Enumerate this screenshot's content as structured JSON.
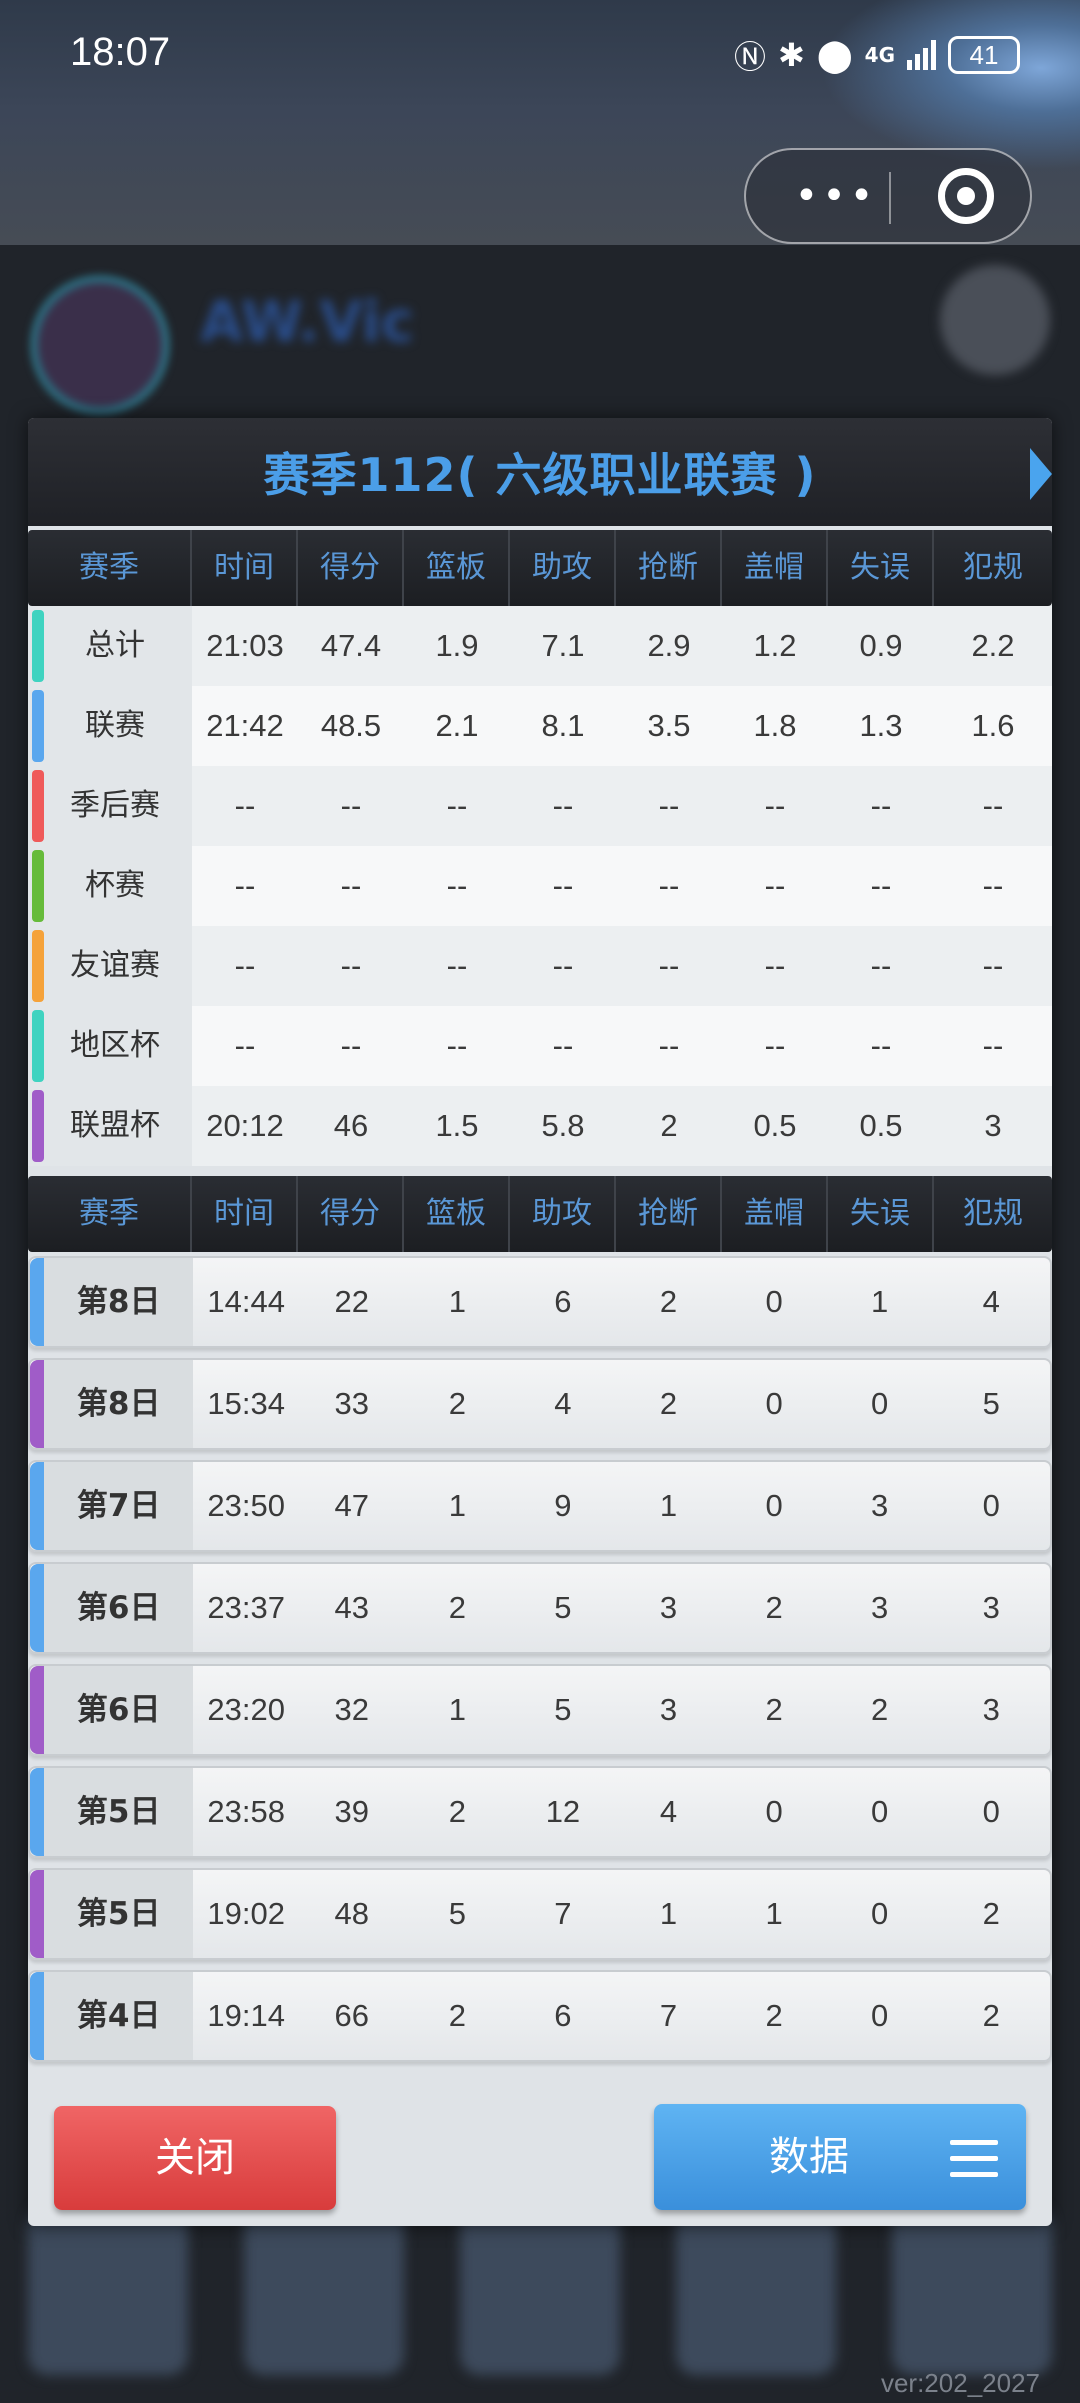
{
  "status_bar": {
    "time": "18:07",
    "network": "4G",
    "battery": "41"
  },
  "capsule": {
    "more_label": "•••"
  },
  "version": "ver:202_2027",
  "modal": {
    "title": "赛季112( 六级职业联赛 )",
    "columns": [
      "赛季",
      "时间",
      "得分",
      "篮板",
      "助攻",
      "抢断",
      "盖帽",
      "失误",
      "犯规"
    ],
    "summary_rows": [
      {
        "label": "总计",
        "color": "#3fd3c0",
        "values": [
          "21:03",
          "47.4",
          "1.9",
          "7.1",
          "2.9",
          "1.2",
          "0.9",
          "2.2"
        ]
      },
      {
        "label": "联赛",
        "color": "#5aa7ee",
        "values": [
          "21:42",
          "48.5",
          "2.1",
          "8.1",
          "3.5",
          "1.8",
          "1.3",
          "1.6"
        ]
      },
      {
        "label": "季后赛",
        "color": "#ef5a5a",
        "values": [
          "--",
          "--",
          "--",
          "--",
          "--",
          "--",
          "--",
          "--"
        ]
      },
      {
        "label": "杯赛",
        "color": "#66bb3a",
        "values": [
          "--",
          "--",
          "--",
          "--",
          "--",
          "--",
          "--",
          "--"
        ]
      },
      {
        "label": "友谊赛",
        "color": "#f5a23a",
        "values": [
          "--",
          "--",
          "--",
          "--",
          "--",
          "--",
          "--",
          "--"
        ]
      },
      {
        "label": "地区杯",
        "color": "#3fd3c0",
        "values": [
          "--",
          "--",
          "--",
          "--",
          "--",
          "--",
          "--",
          "--"
        ]
      },
      {
        "label": "联盟杯",
        "color": "#a05cc8",
        "values": [
          "20:12",
          "46",
          "1.5",
          "5.8",
          "2",
          "0.5",
          "0.5",
          "3"
        ]
      }
    ],
    "game_rows": [
      {
        "label": "第8日",
        "color": "#5aa7ee",
        "values": [
          "14:44",
          "22",
          "1",
          "6",
          "2",
          "0",
          "1",
          "4"
        ]
      },
      {
        "label": "第8日",
        "color": "#a05cc8",
        "values": [
          "15:34",
          "33",
          "2",
          "4",
          "2",
          "0",
          "0",
          "5"
        ]
      },
      {
        "label": "第7日",
        "color": "#5aa7ee",
        "values": [
          "23:50",
          "47",
          "1",
          "9",
          "1",
          "0",
          "3",
          "0"
        ]
      },
      {
        "label": "第6日",
        "color": "#5aa7ee",
        "values": [
          "23:37",
          "43",
          "2",
          "5",
          "3",
          "2",
          "3",
          "3"
        ]
      },
      {
        "label": "第6日",
        "color": "#a05cc8",
        "values": [
          "23:20",
          "32",
          "1",
          "5",
          "3",
          "2",
          "2",
          "3"
        ]
      },
      {
        "label": "第5日",
        "color": "#5aa7ee",
        "values": [
          "23:58",
          "39",
          "2",
          "12",
          "4",
          "0",
          "0",
          "0"
        ]
      },
      {
        "label": "第5日",
        "color": "#a05cc8",
        "values": [
          "19:02",
          "48",
          "5",
          "7",
          "1",
          "1",
          "0",
          "2"
        ]
      },
      {
        "label": "第4日",
        "color": "#5aa7ee",
        "values": [
          "19:14",
          "66",
          "2",
          "6",
          "7",
          "2",
          "0",
          "2"
        ]
      }
    ],
    "close_label": "关闭",
    "data_label": "数据"
  }
}
